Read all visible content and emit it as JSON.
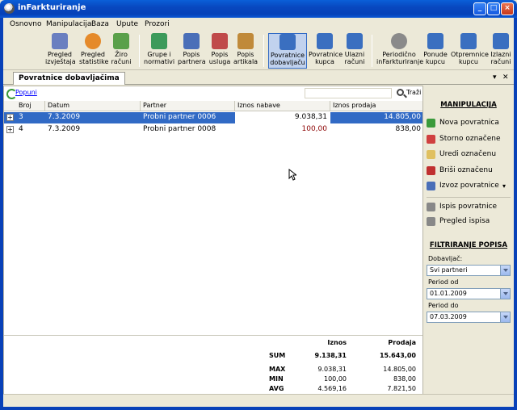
{
  "window": {
    "title": "inFarkturiranje"
  },
  "menu": [
    "Osnovno",
    "Manipulacija",
    "Baza",
    "Upute",
    "Prozori"
  ],
  "toolbar": [
    {
      "label1": "Pregled",
      "label2": "izvještaja",
      "icon": "report-icon",
      "color": "#6a7fc0"
    },
    {
      "label1": "Pregled",
      "label2": "statistike",
      "icon": "pie-chart-icon",
      "color": "#e58a2a"
    },
    {
      "label1": "Žiro",
      "label2": "računi",
      "icon": "bank-icon",
      "color": "#5aa04a"
    },
    {
      "label1": "Grupe i",
      "label2": "normativi",
      "icon": "groups-icon",
      "color": "#3c9a5a"
    },
    {
      "label1": "Popis",
      "label2": "partnera",
      "icon": "partners-icon",
      "color": "#4a6fb8"
    },
    {
      "label1": "Popis",
      "label2": "usluga",
      "icon": "services-icon",
      "color": "#c04a4a"
    },
    {
      "label1": "Popis",
      "label2": "artikala",
      "icon": "articles-icon",
      "color": "#c08a3a"
    },
    {
      "label1": "Povratnice",
      "label2": "dobavljaču",
      "icon": "truck-icon",
      "color": "#3a6fc0"
    },
    {
      "label1": "Povratnice",
      "label2": "kupca",
      "icon": "truck-icon",
      "color": "#3a6fc0"
    },
    {
      "label1": "Ulazni",
      "label2": "računi",
      "icon": "truck-icon",
      "color": "#3a6fc0"
    },
    {
      "label1": "Periodično",
      "label2": "inFarkturiranje",
      "icon": "clock-icon",
      "color": "#8a8a8a"
    },
    {
      "label1": "Ponude",
      "label2": "kupcu",
      "icon": "truck-icon",
      "color": "#3a6fc0"
    },
    {
      "label1": "Otpremnice",
      "label2": "kupcu",
      "icon": "truck-icon",
      "color": "#3a6fc0"
    },
    {
      "label1": "Izlazni",
      "label2": "računi",
      "icon": "truck-icon",
      "color": "#3a6fc0"
    }
  ],
  "tab": {
    "label": "Povratnice dobavljačima"
  },
  "subbar": {
    "refresh": "Popuni",
    "search": "Traži"
  },
  "grid": {
    "columns": [
      "Broj",
      "Datum",
      "Partner",
      "Iznos nabave",
      "Iznos prodaja"
    ],
    "rows": [
      {
        "broj": "3",
        "datum": "7.3.2009",
        "partner": "Probni partner 0006",
        "nabava": "9.038,31",
        "prodaja": "14.805,00"
      },
      {
        "broj": "4",
        "datum": "7.3.2009",
        "partner": "Probni partner 0008",
        "nabava": "100,00",
        "prodaja": "838,00"
      }
    ]
  },
  "summary": {
    "h_iznos": "Iznos",
    "h_prodaja": "Prodaja",
    "sum_label": "SUM",
    "sum_iznos": "9.138,31",
    "sum_prodaja": "15.643,00",
    "max_label": "MAX",
    "max_iznos": "9.038,31",
    "max_prodaja": "14.805,00",
    "min_label": "MIN",
    "min_iznos": "100,00",
    "min_prodaja": "838,00",
    "avg_label": "AVG",
    "avg_iznos": "4.569,16",
    "avg_prodaja": "7.821,50"
  },
  "panel": {
    "manip_title": "MANIPULACIJA",
    "actions": [
      "Nova povratnica",
      "Storno označene",
      "Uredi označenu",
      "Briši označenu",
      "Izvoz povratnice"
    ],
    "print_actions": [
      "Ispis povratnice",
      "Pregled ispisa"
    ],
    "filter_title": "FILTRIRANJE POPISA",
    "supplier_label": "Dobavljač:",
    "supplier_value": "Svi partneri",
    "from_label": "Period od",
    "from_value": "01.01.2009",
    "to_label": "Period do",
    "to_value": "07.03.2009"
  },
  "colors": {
    "selection": "#316ac5",
    "titlebar": "#0848c0"
  }
}
